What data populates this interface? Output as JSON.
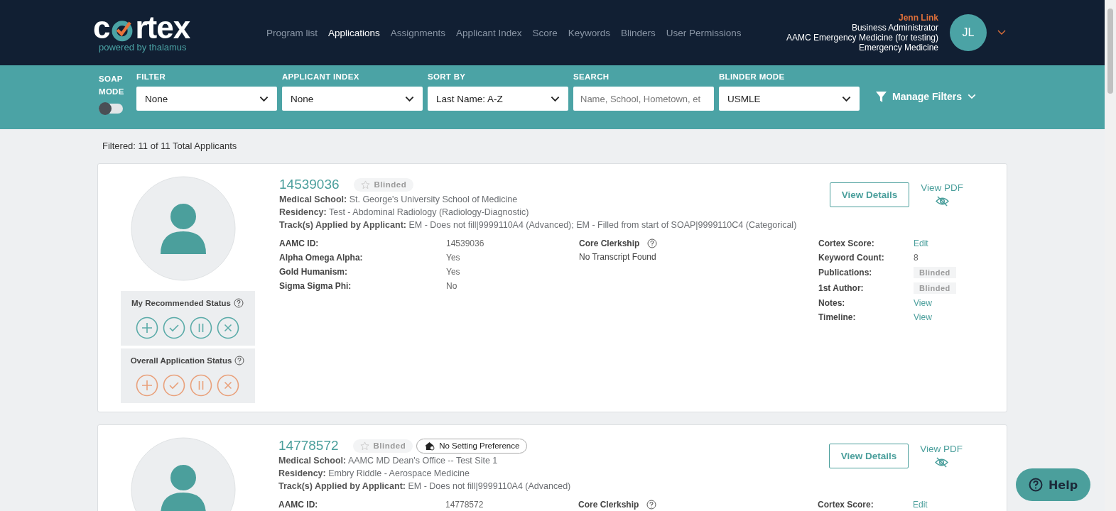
{
  "logo": {
    "before": "c",
    "after": "rtex",
    "tagline": "powered by thalamus"
  },
  "nav": [
    {
      "label": "Program list",
      "selected": false
    },
    {
      "label": "Applications",
      "selected": true
    },
    {
      "label": "Assignments",
      "selected": false
    },
    {
      "label": "Applicant Index",
      "selected": false
    },
    {
      "label": "Score",
      "selected": false
    },
    {
      "label": "Keywords",
      "selected": false
    },
    {
      "label": "Blinders",
      "selected": false
    },
    {
      "label": "User Permissions",
      "selected": false
    }
  ],
  "user": {
    "name": "Jenn Link",
    "role": "Business Administrator",
    "program": "AAMC Emergency Medicine (for testing)",
    "specialty": "Emergency Medicine",
    "initials": "JL"
  },
  "soap_mode": {
    "label": "SOAP MODE",
    "on": false
  },
  "filters": [
    {
      "kind": "select",
      "label": "FILTER",
      "value": "None"
    },
    {
      "kind": "select",
      "label": "APPLICANT INDEX",
      "value": "None"
    },
    {
      "kind": "select",
      "label": "SORT BY",
      "value": "Last Name: A-Z"
    },
    {
      "kind": "search",
      "label": "SEARCH",
      "placeholder": "Name, School, Hometown, et"
    },
    {
      "kind": "select",
      "label": "BLINDER MODE",
      "value": "USMLE"
    }
  ],
  "manage_filters": "Manage Filters",
  "summary": "Filtered: 11 of 11 Total Applicants",
  "applicants": [
    {
      "id": "14539036",
      "star_label": "Blinded",
      "lines": [
        "**Medical School:**  St. George's University School of Medicine",
        "**Residency:**  Test - Abdominal Radiology (Radiology-Diagnostic)",
        "**Track(s) Applied by Applicant:** EM - Does not fill|9999110A4 (Advanced); EM - Filled from start of SOAP|9999110C4 (Categorical)"
      ],
      "details": [
        {
          "label": "AAMC ID:",
          "value": "14539036"
        },
        {
          "label": "Alpha Omega Alpha:",
          "value": "Yes"
        },
        {
          "label": "Gold Humanism:",
          "value": "Yes"
        },
        {
          "label": "Sigma Sigma Phi:",
          "value": "No"
        }
      ],
      "clerkship": {
        "title": "Core Clerkship",
        "value": "No Transcript Found"
      },
      "scores": [
        {
          "label": "Cortex Score:",
          "kind": "link",
          "value": "Edit"
        },
        {
          "label": "Keyword Count:",
          "kind": "text",
          "value": "8"
        },
        {
          "label": "Publications:",
          "kind": "blinded",
          "value": "Blinded"
        },
        {
          "label": "1st Author:",
          "kind": "blinded",
          "value": "Blinded"
        },
        {
          "label": "Notes:",
          "kind": "link",
          "value": "View"
        },
        {
          "label": "Timeline:",
          "kind": "link",
          "value": "View"
        }
      ],
      "view_details": "View Details",
      "view_pdf": "View PDF",
      "statuses": [
        {
          "title": "My Recommended Status",
          "color": "#5aaba8"
        },
        {
          "title": "Overall Application Status",
          "color": "#e9a07a"
        }
      ]
    },
    {
      "id": "14778572",
      "star_label": "Blinded",
      "setting_badge": "No Setting Preference",
      "lines": [
        "**Medical School:**  AAMC MD Dean's Office -- Test Site 1",
        "**Residency:**  Embry Riddle - Aerospace Medicine",
        "**Track(s) Applied by Applicant:** EM - Does not fill|9999110A4 (Advanced)"
      ],
      "details": [
        {
          "label": "AAMC ID:",
          "value": "14778572"
        }
      ],
      "clerkship": {
        "title": "Core Clerkship"
      },
      "scores": [
        {
          "label": "Cortex Score:",
          "kind": "link",
          "value": "Edit"
        }
      ],
      "view_details": "View Details",
      "view_pdf": "View PDF"
    }
  ],
  "help": "Help"
}
